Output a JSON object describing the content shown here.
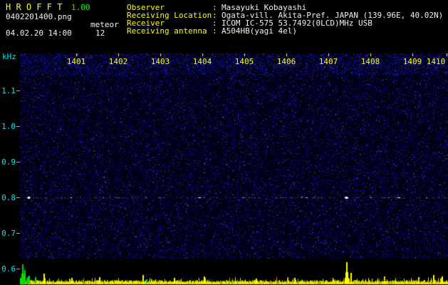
{
  "header": {
    "title": "H R O F F T",
    "version": "1.00",
    "filename": "0402201400.png",
    "mode": "meteor",
    "datetime": "04.02.20 14:00",
    "echo_count": "12"
  },
  "info": {
    "sep": ":",
    "rows": [
      {
        "label": "Observer",
        "value": "Masayuki Kobayashi"
      },
      {
        "label": "Receiving Location",
        "value": "Ogata-vill. Akita-Pref. JAPAN (139.96E, 40.02N)"
      },
      {
        "label": "Receiver",
        "value": "ICOM IC-575 53.7492(0LCD)MHz USB"
      },
      {
        "label": "Receiving antenna",
        "value": "A504HB(yagi 4el)"
      }
    ]
  },
  "chart_data": {
    "type": "heatmap",
    "title": "HROFFT 10-minute radio meteor observation spectrogram with signal-level strip",
    "date": "04.02.20",
    "time_start": "14:00",
    "time_end": "14:10",
    "echo_count": 12,
    "x_axis": {
      "ticks": [
        "1401",
        "1402",
        "1403",
        "1404",
        "1405",
        "1406",
        "1407",
        "1408",
        "1409",
        "1410"
      ]
    },
    "y_axis": {
      "unit": "kHz",
      "ticks": [
        "1.1",
        "1.0",
        "0.9",
        "0.8",
        "0.7",
        "0.6"
      ],
      "min": 0.6,
      "max": 1.15
    },
    "carrier_line_khz": 0.8,
    "colors": {
      "background": "#000012",
      "axis": "#00e8e8",
      "time_labels": "#ffff00",
      "trace": "#e8e800",
      "event_yellow": "#ffff00",
      "event_green": "#00dd00",
      "event_cyan": "#00cccc",
      "event_red": "#cc2020"
    },
    "spectrogram_events": [
      {
        "t_min": 0.2,
        "f_khz": 0.8,
        "color": "#ff5050",
        "w": 6
      },
      {
        "t_min": 1.2,
        "f_khz": 0.8,
        "color": "#ffffff",
        "w": 2
      },
      {
        "t_min": 2.95,
        "f_khz": 0.8,
        "color": "#00e0e0",
        "w": 2
      },
      {
        "t_min": 4.2,
        "f_khz": 0.8,
        "color": "#ffffff",
        "w": 3
      },
      {
        "t_min": 5.2,
        "f_khz": 0.8,
        "color": "#ff80ff",
        "w": 2
      },
      {
        "t_min": 6.7,
        "f_khz": 0.8,
        "color": "#ffffff",
        "w": 2
      },
      {
        "t_min": 7.62,
        "f_khz": 0.8,
        "color": "#ffffff",
        "w": 5
      },
      {
        "t_min": 8.2,
        "f_khz": 0.8,
        "color": "#ff80c0",
        "w": 2
      },
      {
        "t_min": 8.85,
        "f_khz": 0.8,
        "color": "#ffffff",
        "w": 4
      },
      {
        "t_min": 9.5,
        "f_khz": 0.8,
        "color": "#ff80ff",
        "w": 2
      }
    ],
    "level_events": [
      {
        "t_min": 0.05,
        "h": 26,
        "color": "green"
      },
      {
        "t_min": 0.1,
        "h": 18,
        "color": "green"
      },
      {
        "t_min": 0.2,
        "h": 10,
        "color": "green"
      },
      {
        "t_min": 0.35,
        "h": 8,
        "color": "green"
      },
      {
        "t_min": 0.55,
        "h": 13,
        "color": "yellow"
      },
      {
        "t_min": 1.2,
        "h": 7,
        "color": "yellow"
      },
      {
        "t_min": 1.85,
        "h": 8,
        "color": "yellow"
      },
      {
        "t_min": 2.86,
        "h": 11,
        "color": "yellow"
      },
      {
        "t_min": 2.95,
        "h": 5,
        "color": "cyan"
      },
      {
        "t_min": 3.6,
        "h": 7,
        "color": "yellow"
      },
      {
        "t_min": 4.3,
        "h": 9,
        "color": "yellow"
      },
      {
        "t_min": 5.5,
        "h": 6,
        "color": "yellow"
      },
      {
        "t_min": 6.4,
        "h": 7,
        "color": "yellow"
      },
      {
        "t_min": 7.62,
        "h": 29,
        "color": "yellow"
      },
      {
        "t_min": 7.72,
        "h": 14,
        "color": "yellow"
      },
      {
        "t_min": 8.5,
        "h": 9,
        "color": "yellow"
      },
      {
        "t_min": 9.3,
        "h": 8,
        "color": "yellow"
      },
      {
        "t_min": 9.65,
        "h": 11,
        "color": "yellow"
      },
      {
        "t_min": 9.85,
        "h": 9,
        "color": "yellow"
      }
    ]
  }
}
